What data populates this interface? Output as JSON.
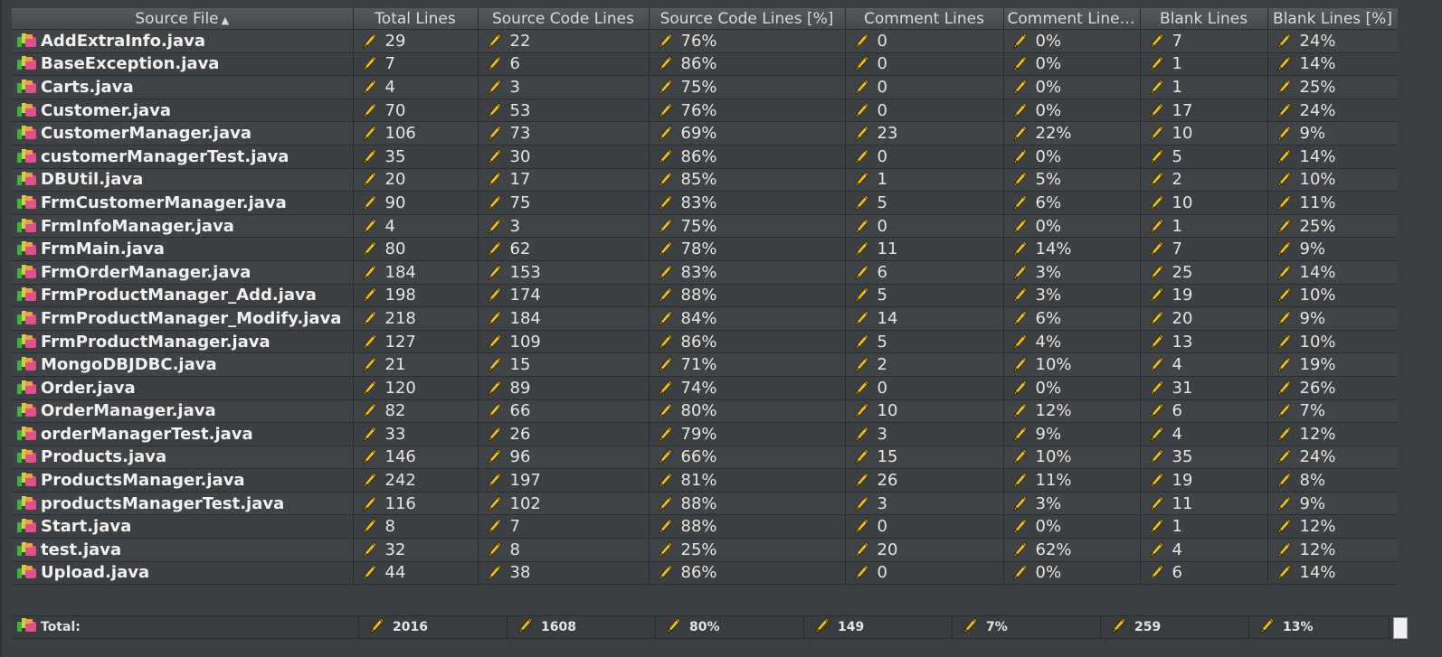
{
  "columns": [
    {
      "label": "Source File",
      "sorted": true
    },
    {
      "label": "Total Lines"
    },
    {
      "label": "Source Code Lines"
    },
    {
      "label": "Source Code Lines [%]"
    },
    {
      "label": "Comment Lines"
    },
    {
      "label": "Comment Lines ..."
    },
    {
      "label": "Blank Lines"
    },
    {
      "label": "Blank Lines [%]"
    }
  ],
  "sort_indicator": "▲",
  "rows": [
    {
      "file": "AddExtraInfo.java",
      "total": "29",
      "src": "22",
      "src_pct": "76%",
      "cmt": "0",
      "cmt_pct": "0%",
      "blank": "7",
      "blank_pct": "24%"
    },
    {
      "file": "BaseException.java",
      "total": "7",
      "src": "6",
      "src_pct": "86%",
      "cmt": "0",
      "cmt_pct": "0%",
      "blank": "1",
      "blank_pct": "14%"
    },
    {
      "file": "Carts.java",
      "total": "4",
      "src": "3",
      "src_pct": "75%",
      "cmt": "0",
      "cmt_pct": "0%",
      "blank": "1",
      "blank_pct": "25%"
    },
    {
      "file": "Customer.java",
      "total": "70",
      "src": "53",
      "src_pct": "76%",
      "cmt": "0",
      "cmt_pct": "0%",
      "blank": "17",
      "blank_pct": "24%"
    },
    {
      "file": "CustomerManager.java",
      "total": "106",
      "src": "73",
      "src_pct": "69%",
      "cmt": "23",
      "cmt_pct": "22%",
      "blank": "10",
      "blank_pct": "9%"
    },
    {
      "file": "customerManagerTest.java",
      "total": "35",
      "src": "30",
      "src_pct": "86%",
      "cmt": "0",
      "cmt_pct": "0%",
      "blank": "5",
      "blank_pct": "14%"
    },
    {
      "file": "DBUtil.java",
      "total": "20",
      "src": "17",
      "src_pct": "85%",
      "cmt": "1",
      "cmt_pct": "5%",
      "blank": "2",
      "blank_pct": "10%"
    },
    {
      "file": "FrmCustomerManager.java",
      "total": "90",
      "src": "75",
      "src_pct": "83%",
      "cmt": "5",
      "cmt_pct": "6%",
      "blank": "10",
      "blank_pct": "11%"
    },
    {
      "file": "FrmInfoManager.java",
      "total": "4",
      "src": "3",
      "src_pct": "75%",
      "cmt": "0",
      "cmt_pct": "0%",
      "blank": "1",
      "blank_pct": "25%"
    },
    {
      "file": "FrmMain.java",
      "total": "80",
      "src": "62",
      "src_pct": "78%",
      "cmt": "11",
      "cmt_pct": "14%",
      "blank": "7",
      "blank_pct": "9%"
    },
    {
      "file": "FrmOrderManager.java",
      "total": "184",
      "src": "153",
      "src_pct": "83%",
      "cmt": "6",
      "cmt_pct": "3%",
      "blank": "25",
      "blank_pct": "14%"
    },
    {
      "file": "FrmProductManager_Add.java",
      "total": "198",
      "src": "174",
      "src_pct": "88%",
      "cmt": "5",
      "cmt_pct": "3%",
      "blank": "19",
      "blank_pct": "10%"
    },
    {
      "file": "FrmProductManager_Modify.java",
      "total": "218",
      "src": "184",
      "src_pct": "84%",
      "cmt": "14",
      "cmt_pct": "6%",
      "blank": "20",
      "blank_pct": "9%"
    },
    {
      "file": "FrmProductManager.java",
      "total": "127",
      "src": "109",
      "src_pct": "86%",
      "cmt": "5",
      "cmt_pct": "4%",
      "blank": "13",
      "blank_pct": "10%"
    },
    {
      "file": "MongoDBJDBC.java",
      "total": "21",
      "src": "15",
      "src_pct": "71%",
      "cmt": "2",
      "cmt_pct": "10%",
      "blank": "4",
      "blank_pct": "19%"
    },
    {
      "file": "Order.java",
      "total": "120",
      "src": "89",
      "src_pct": "74%",
      "cmt": "0",
      "cmt_pct": "0%",
      "blank": "31",
      "blank_pct": "26%"
    },
    {
      "file": "OrderManager.java",
      "total": "82",
      "src": "66",
      "src_pct": "80%",
      "cmt": "10",
      "cmt_pct": "12%",
      "blank": "6",
      "blank_pct": "7%"
    },
    {
      "file": "orderManagerTest.java",
      "total": "33",
      "src": "26",
      "src_pct": "79%",
      "cmt": "3",
      "cmt_pct": "9%",
      "blank": "4",
      "blank_pct": "12%"
    },
    {
      "file": "Products.java",
      "total": "146",
      "src": "96",
      "src_pct": "66%",
      "cmt": "15",
      "cmt_pct": "10%",
      "blank": "35",
      "blank_pct": "24%"
    },
    {
      "file": "ProductsManager.java",
      "total": "242",
      "src": "197",
      "src_pct": "81%",
      "cmt": "26",
      "cmt_pct": "11%",
      "blank": "19",
      "blank_pct": "8%"
    },
    {
      "file": "productsManagerTest.java",
      "total": "116",
      "src": "102",
      "src_pct": "88%",
      "cmt": "3",
      "cmt_pct": "3%",
      "blank": "11",
      "blank_pct": "9%"
    },
    {
      "file": "Start.java",
      "total": "8",
      "src": "7",
      "src_pct": "88%",
      "cmt": "0",
      "cmt_pct": "0%",
      "blank": "1",
      "blank_pct": "12%"
    },
    {
      "file": "test.java",
      "total": "32",
      "src": "8",
      "src_pct": "25%",
      "cmt": "20",
      "cmt_pct": "62%",
      "blank": "4",
      "blank_pct": "12%"
    },
    {
      "file": "Upload.java",
      "total": "44",
      "src": "38",
      "src_pct": "86%",
      "cmt": "0",
      "cmt_pct": "0%",
      "blank": "6",
      "blank_pct": "14%"
    }
  ],
  "totals": {
    "label": "Total:",
    "total": "2016",
    "src": "1608",
    "src_pct": "80%",
    "cmt": "149",
    "cmt_pct": "7%",
    "blank": "259",
    "blank_pct": "13%"
  },
  "icons": {
    "file": "java-file-icon",
    "metric": "pencil-icon"
  },
  "colors": {
    "background": "#3c3f41",
    "header": "#4d5154",
    "text": "#e4e4e4"
  }
}
